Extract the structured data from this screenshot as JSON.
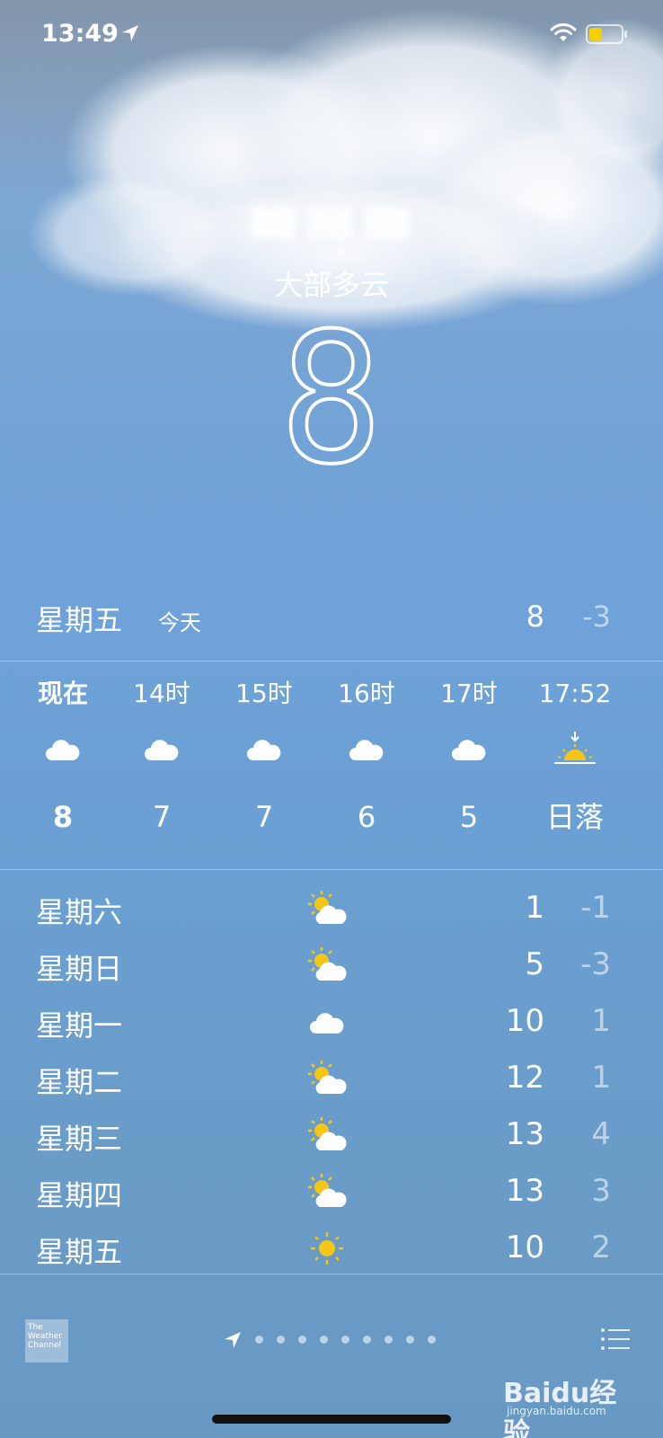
{
  "status_bar": {
    "time": "13:49"
  },
  "header": {
    "location": "",
    "condition": "大部多云",
    "temperature": "8"
  },
  "today": {
    "day": "星期五",
    "tag": "今天",
    "high": "8",
    "low": "-3"
  },
  "hourly": [
    {
      "label": "现在",
      "icon": "cloud-icon",
      "temp": "8",
      "bold": true
    },
    {
      "label": "14时",
      "icon": "cloud-icon",
      "temp": "7"
    },
    {
      "label": "15时",
      "icon": "cloud-icon",
      "temp": "7"
    },
    {
      "label": "16时",
      "icon": "cloud-icon",
      "temp": "6"
    },
    {
      "label": "17时",
      "icon": "cloud-icon",
      "temp": "5"
    },
    {
      "label": "17:52",
      "icon": "sunset-icon",
      "temp": "日落"
    }
  ],
  "daily": [
    {
      "day": "星期六",
      "icon": "partly-cloudy-icon",
      "high": "1",
      "low": "-1"
    },
    {
      "day": "星期日",
      "icon": "partly-cloudy-icon",
      "high": "5",
      "low": "-3"
    },
    {
      "day": "星期一",
      "icon": "cloud-icon",
      "high": "10",
      "low": "1"
    },
    {
      "day": "星期二",
      "icon": "partly-cloudy-icon",
      "high": "12",
      "low": "1"
    },
    {
      "day": "星期三",
      "icon": "partly-cloudy-icon",
      "high": "13",
      "low": "4"
    },
    {
      "day": "星期四",
      "icon": "partly-cloudy-icon",
      "high": "13",
      "low": "3"
    },
    {
      "day": "星期五",
      "icon": "sun-icon",
      "high": "10",
      "low": "2"
    }
  ],
  "footer": {
    "provider_logo_text": "The Weather Channel",
    "page_count": 9
  },
  "watermark": {
    "brand": "Baidu经验",
    "site": "jingyan.baidu.com"
  },
  "colors": {
    "sun": "#f5c518",
    "battery": "#f5d000"
  }
}
